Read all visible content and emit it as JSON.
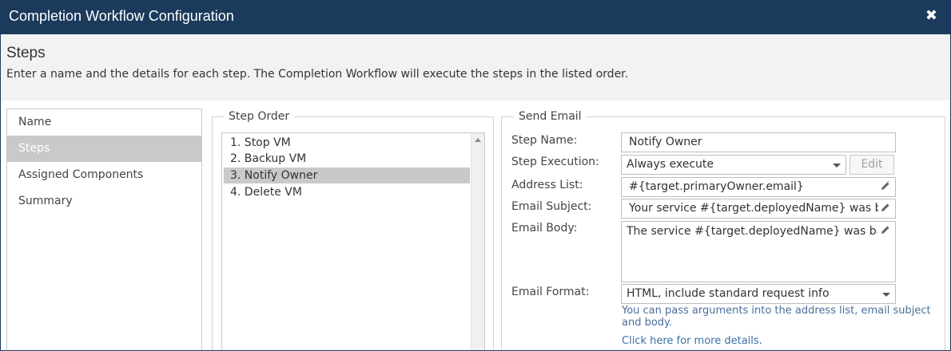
{
  "window": {
    "title": "Completion Workflow Configuration",
    "close_glyph": "✖"
  },
  "header": {
    "title": "Steps",
    "description": "Enter a name and the details for each step. The Completion Workflow will execute the steps in the listed order."
  },
  "nav": {
    "items": [
      {
        "label": "Name",
        "active": false
      },
      {
        "label": "Steps",
        "active": true
      },
      {
        "label": "Assigned Components",
        "active": false
      },
      {
        "label": "Summary",
        "active": false
      }
    ]
  },
  "step_order": {
    "legend": "Step Order",
    "items": [
      {
        "label": "1. Stop VM",
        "selected": false
      },
      {
        "label": "2. Backup VM",
        "selected": false
      },
      {
        "label": "3. Notify Owner",
        "selected": true
      },
      {
        "label": "4. Delete VM",
        "selected": false
      }
    ]
  },
  "send_email": {
    "legend": "Send Email",
    "step_name": {
      "label": "Step Name:",
      "value": "Notify Owner"
    },
    "step_execution": {
      "label": "Step Execution:",
      "value": "Always execute",
      "edit_label": "Edit"
    },
    "address_list": {
      "label": "Address List:",
      "value": "#{target.primaryOwner.email}"
    },
    "email_subject": {
      "label": "Email Subject:",
      "value": "Your service #{target.deployedName} was b"
    },
    "email_body": {
      "label": "Email Body:",
      "value": "The service #{target.deployedName} was ba"
    },
    "email_format": {
      "label": "Email Format:",
      "value": "HTML, include standard request info"
    },
    "hint": "You can pass arguments into the address list, email subject and body.",
    "link": "Click here for more details."
  },
  "colors": {
    "titlebar": "#1b3a5c",
    "selection": "#c9c9c9",
    "link": "#3a6ea5"
  },
  "icons": [
    "close-icon",
    "pencil-icon",
    "chevron-down-icon",
    "scroll-up-arrow-icon"
  ]
}
